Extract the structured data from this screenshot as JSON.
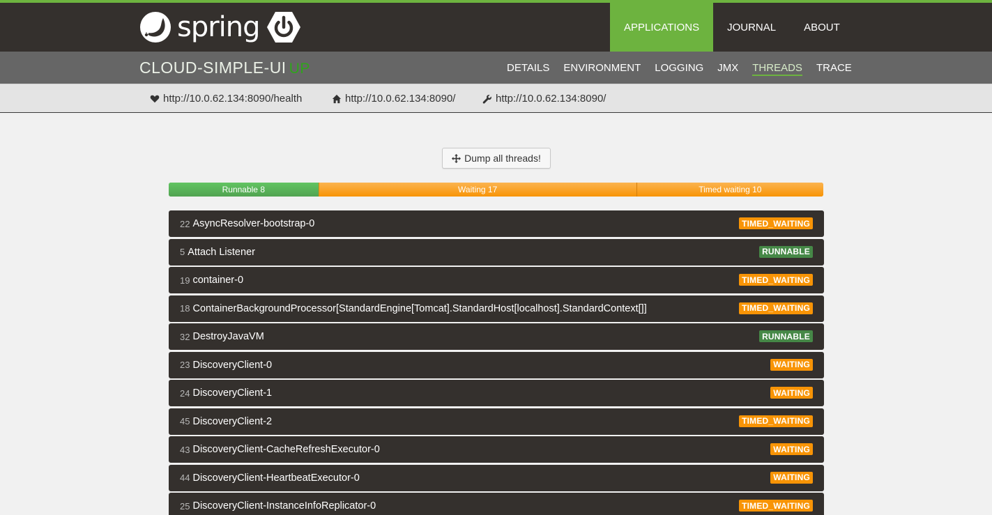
{
  "brand": {
    "logo_text": "spring"
  },
  "colors": {
    "brand_green": "#6db33f",
    "navbar_bg": "#34302d",
    "runnable": "#468847",
    "waiting": "#f89406",
    "status_up": "#2ea51b"
  },
  "main_nav": {
    "applications": "APPLICATIONS",
    "journal": "JOURNAL",
    "about": "ABOUT"
  },
  "app": {
    "name": "CLOUD-SIMPLE-UI",
    "status": "UP"
  },
  "sub_nav": {
    "details": "DETAILS",
    "environment": "ENVIRONMENT",
    "logging": "LOGGING",
    "jmx": "JMX",
    "threads": "THREADS",
    "trace": "TRACE"
  },
  "urls": {
    "health": {
      "icon": "heart-icon",
      "text": "http://10.0.62.134:8090/health"
    },
    "home": {
      "icon": "home-icon",
      "text": "http://10.0.62.134:8090/"
    },
    "management": {
      "icon": "wrench-icon",
      "text": "http://10.0.62.134:8090/"
    }
  },
  "dump_button": {
    "label": "Dump all threads!",
    "icon": "move-icon"
  },
  "summary": {
    "runnable": {
      "label": "Runnable 8",
      "count": 8
    },
    "waiting": {
      "label": "Waiting 17",
      "count": 17
    },
    "timed_waiting": {
      "label": "Timed waiting 10",
      "count": 10
    }
  },
  "threads": [
    {
      "id": "22",
      "name": "AsyncResolver-bootstrap-0",
      "state": "TIMED_WAITING"
    },
    {
      "id": "5",
      "name": "Attach Listener",
      "state": "RUNNABLE"
    },
    {
      "id": "19",
      "name": "container-0",
      "state": "TIMED_WAITING"
    },
    {
      "id": "18",
      "name": "ContainerBackgroundProcessor[StandardEngine[Tomcat].StandardHost[localhost].StandardContext[]]",
      "state": "TIMED_WAITING"
    },
    {
      "id": "32",
      "name": "DestroyJavaVM",
      "state": "RUNNABLE"
    },
    {
      "id": "23",
      "name": "DiscoveryClient-0",
      "state": "WAITING"
    },
    {
      "id": "24",
      "name": "DiscoveryClient-1",
      "state": "WAITING"
    },
    {
      "id": "45",
      "name": "DiscoveryClient-2",
      "state": "TIMED_WAITING"
    },
    {
      "id": "43",
      "name": "DiscoveryClient-CacheRefreshExecutor-0",
      "state": "WAITING"
    },
    {
      "id": "44",
      "name": "DiscoveryClient-HeartbeatExecutor-0",
      "state": "WAITING"
    },
    {
      "id": "25",
      "name": "DiscoveryClient-InstanceInfoReplicator-0",
      "state": "TIMED_WAITING"
    }
  ]
}
